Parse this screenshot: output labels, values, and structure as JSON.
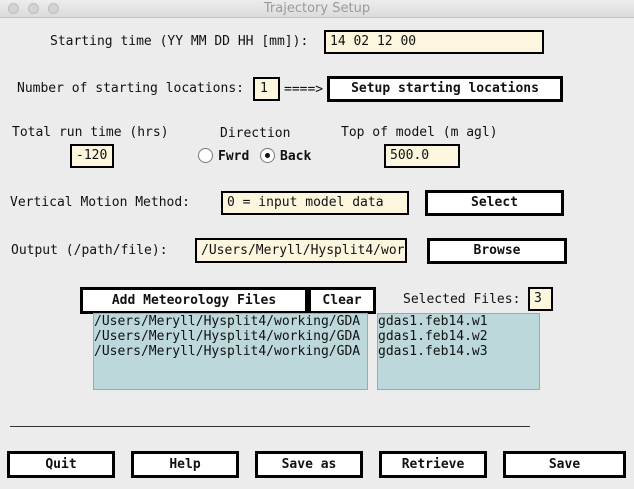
{
  "window": {
    "title": "Trajectory Setup"
  },
  "start_time": {
    "label": "Starting time (YY MM DD HH [mm]):",
    "value": "14 02 12 00"
  },
  "locations": {
    "label": "Number of starting locations:",
    "value": "1",
    "arrow": "====>",
    "setup_button": "Setup starting locations"
  },
  "run": {
    "total_label": "Total run time (hrs)",
    "total_value": "-120",
    "direction_label": "Direction",
    "fwrd_label": "Fwrd",
    "back_label": "Back",
    "selected_direction": "Back",
    "top_label": "Top of model (m agl)",
    "top_value": "500.0"
  },
  "vertical": {
    "label": "Vertical Motion Method:",
    "value": "0 = input model data",
    "select_button": "Select"
  },
  "output": {
    "label": "Output (/path/file):",
    "value": "/Users/Meryll/Hysplit4/wor",
    "browse_button": "Browse"
  },
  "meteo": {
    "add_button": "Add Meteorology Files",
    "clear_button": "Clear",
    "selected_label": "Selected Files:",
    "selected_count": "3",
    "paths": [
      "/Users/Meryll/Hysplit4/working/GDA",
      "/Users/Meryll/Hysplit4/working/GDA",
      "/Users/Meryll/Hysplit4/working/GDA"
    ],
    "files": [
      "gdas1.feb14.w1",
      "gdas1.feb14.w2",
      "gdas1.feb14.w3"
    ]
  },
  "footer": {
    "quit": "Quit",
    "help": "Help",
    "save_as": "Save as",
    "retrieve": "Retrieve",
    "save": "Save"
  }
}
